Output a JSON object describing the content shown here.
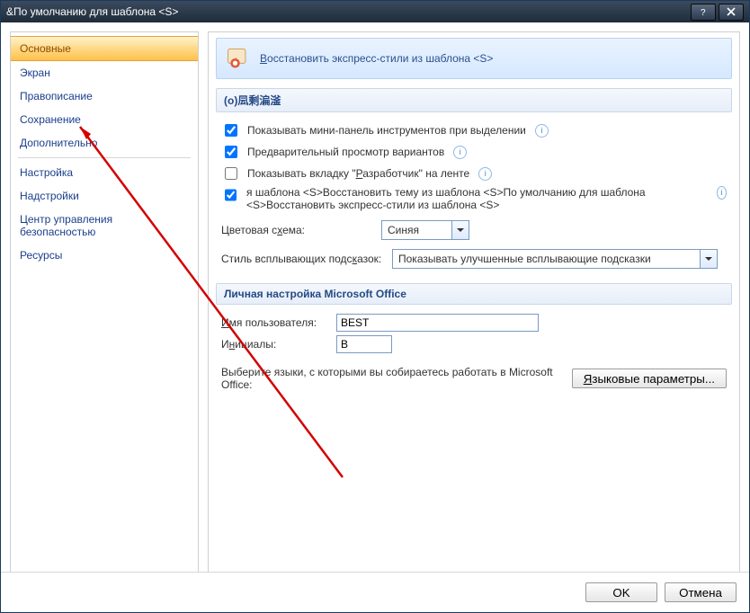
{
  "title": "&По умолчанию для шаблона <S>",
  "sidebar": {
    "items": [
      {
        "label": "Основные",
        "selected": true
      },
      {
        "label": "Экран"
      },
      {
        "label": "Правописание"
      },
      {
        "label": "Сохранение"
      },
      {
        "label": "Дополнительно"
      },
      {
        "sep": true
      },
      {
        "label": "Настройка"
      },
      {
        "label": "Надстройки"
      },
      {
        "label": "Центр управления безопасностью"
      },
      {
        "label": "Ресурсы"
      }
    ]
  },
  "banner": {
    "text": "Восстановить экспресс-стили из шаблона <S>"
  },
  "group1": {
    "header": "(o)凨剩㴜滏",
    "chk_mini": {
      "checked": true,
      "label": "Показывать мини-панель инструментов при выделении",
      "info": true
    },
    "chk_preview": {
      "checked": true,
      "label": "Предварительный просмотр вариантов",
      "info": true
    },
    "chk_dev": {
      "checked": false,
      "label": "Показывать вкладку \"Разработчик\" на ленте",
      "info": true,
      "underline_prefix": "Р",
      "rest": "азработчик"
    },
    "chk_template": {
      "checked": true,
      "label": "я шаблона <S>Восстановить тему из шаблона <S>По умолчанию для шаблона <S>Восстановить экспресс-стили из шаблона <S>",
      "info": true
    },
    "color_label": "Цветовая схема:",
    "color_under": "х",
    "color_value": "Синяя",
    "tooltip_label": "Стиль всплывающих подсказок:",
    "tooltip_under": "к",
    "tooltip_value": "Показывать улучшенные всплывающие подсказки"
  },
  "group2": {
    "header": "Личная настройка Microsoft Office",
    "user_label_under": "И",
    "user_label_rest": "мя пользователя:",
    "user_value": "BEST",
    "init_label": "Инициалы:",
    "init_under": "н",
    "init_value": "B",
    "lang_text": "Выберите языки, с которыми вы собираетесь работать в Microsoft Office:",
    "lang_btn": "Языковые параметры...",
    "lang_btn_under": "Я"
  },
  "footer": {
    "ok": "OK",
    "cancel": "Отмена"
  }
}
